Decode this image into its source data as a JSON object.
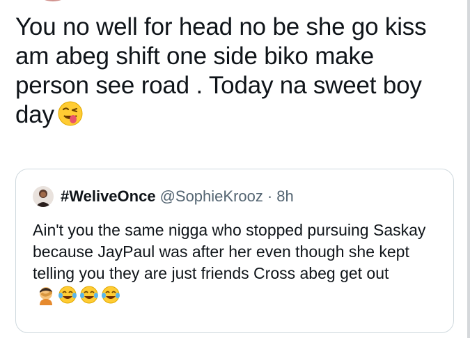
{
  "tweet": {
    "text": "You no well for head no be she go kiss am abeg shift one side biko make person see road . Today na sweet boy day",
    "emoji": "winking-face-with-tongue-icon"
  },
  "quote": {
    "display_name": "#WeliveOnce",
    "handle": "@SophieKrooz",
    "separator": "·",
    "time": "8h",
    "text": "Ain't you the same nigga who stopped pursuing Saskay because JayPaul was after her even though she kept telling you they are just friends Cross abeg get out",
    "emojis": [
      "person-facepalming-icon",
      "face-with-tears-of-joy-icon",
      "face-with-tears-of-joy-icon",
      "face-with-tears-of-joy-icon"
    ]
  },
  "colors": {
    "text": "#0f1419",
    "secondary": "#536471",
    "border": "#cfd9de"
  }
}
